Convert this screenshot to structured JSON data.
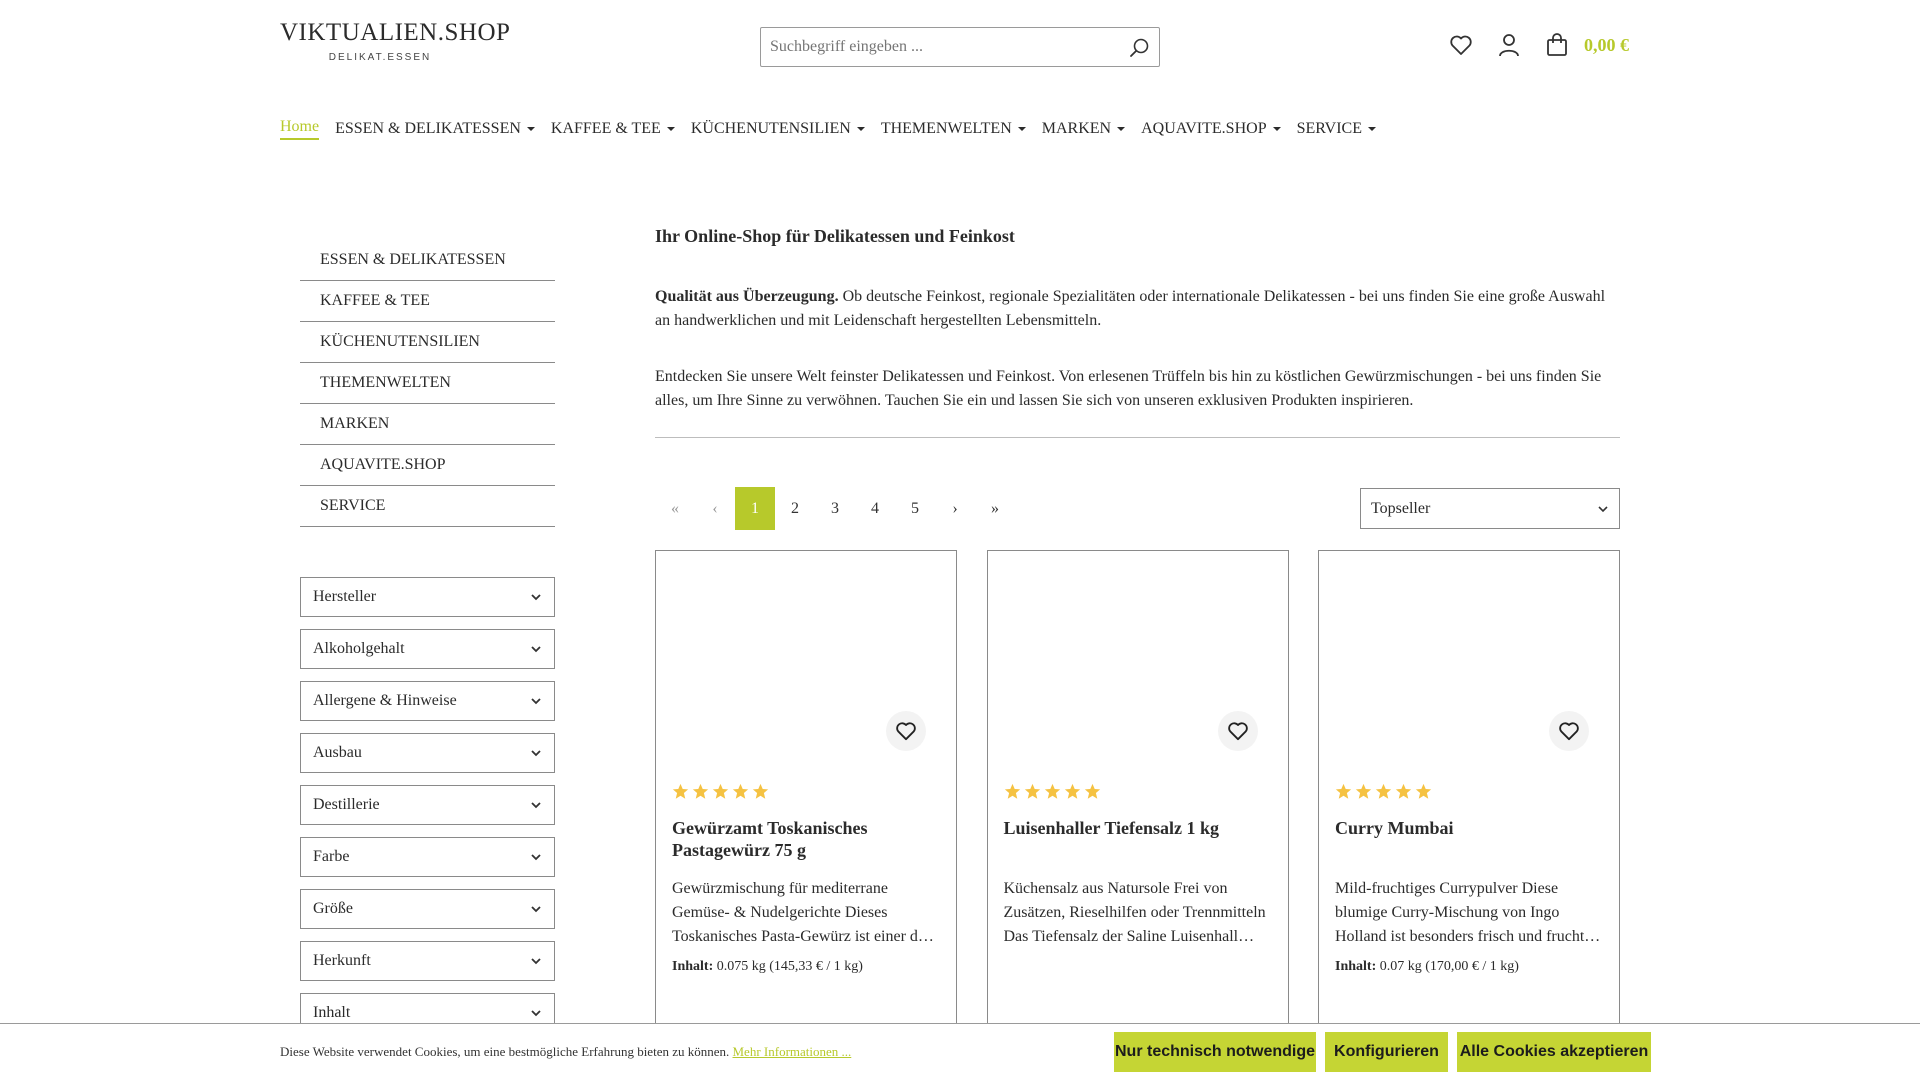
{
  "header": {
    "logo_main": "VIKTUALIEN.SHOP",
    "logo_sub": "DELIKAT.ESSEN",
    "search_placeholder": "Suchbegriff eingeben ...",
    "cart_total": "0,00 €"
  },
  "nav": {
    "items": [
      {
        "label": "Home",
        "active": true,
        "dropdown": false
      },
      {
        "label": "ESSEN & DELIKATESSEN",
        "dropdown": true
      },
      {
        "label": "KAFFEE & TEE",
        "dropdown": true
      },
      {
        "label": "KÜCHENUTENSILIEN",
        "dropdown": true
      },
      {
        "label": "THEMENWELTEN",
        "dropdown": true
      },
      {
        "label": "MARKEN",
        "dropdown": true
      },
      {
        "label": "AQUAVITE.SHOP",
        "dropdown": true
      },
      {
        "label": "SERVICE",
        "dropdown": true
      }
    ]
  },
  "sidebar": {
    "categories": [
      "ESSEN & DELIKATESSEN",
      "KAFFEE & TEE",
      "KÜCHENUTENSILIEN",
      "THEMENWELTEN",
      "MARKEN",
      "AQUAVITE.SHOP",
      "SERVICE"
    ],
    "filters": [
      "Hersteller",
      "Alkoholgehalt",
      "Allergene & Hinweise",
      "Ausbau",
      "Destillerie",
      "Farbe",
      "Größe",
      "Herkunft",
      "Inhalt"
    ]
  },
  "main": {
    "title": "Ihr Online-Shop für Delikatessen und Feinkost",
    "intro_bold": "Qualität aus Überzeugung.",
    "intro_text": " Ob deutsche Feinkost, regionale Spezialitäten oder internationale Delikatessen - bei uns finden Sie eine große Auswahl an handwerklichen und mit Leidenschaft hergestellten Lebensmitteln.",
    "paragraph2": "Entdecken Sie unsere Welt feinster Delikatessen und Feinkost. Von erlesenen Trüffeln bis hin zu köstlichen Gewürzmischungen - bei uns finden Sie alles, um Ihre Sinne zu verwöhnen. Tauchen Sie ein und lassen Sie sich von unseren exklusiven Produkten inspirieren."
  },
  "pagination": {
    "first": "«",
    "prev": "‹",
    "pages": [
      "1",
      "2",
      "3",
      "4",
      "5"
    ],
    "next": "›",
    "last": "»",
    "current": "1"
  },
  "sort": {
    "selected": "Topseller"
  },
  "products": [
    {
      "title": "Gewürzamt Toskanisches Pastagewürz 75 g",
      "description": "Gewürzmischung für mediterrane Gemüse- & Nudelgerichte Dieses Toskanisches Pasta-Gewürz ist einer d…",
      "content_label": "Inhalt:",
      "content_value": "0.075 kg (145,33 € / 1 kg)",
      "rating": 5
    },
    {
      "title": "Luisenhaller Tiefensalz 1 kg",
      "description": "Küchensalz aus Natursole Frei von Zusätzen, Rieselhilfen oder Trennmitteln Das Tiefensalz der Saline Luisenhall…",
      "content_label": "",
      "content_value": "",
      "rating": 5
    },
    {
      "title": "Curry Mumbai",
      "description": "Mild-fruchtiges Currypulver Diese blumige Curry-Mischung von Ingo Holland ist besonders frisch und frucht…",
      "content_label": "Inhalt:",
      "content_value": "0.07 kg (170,00 € / 1 kg)",
      "rating": 5
    }
  ],
  "cookie": {
    "text": "Diese Website verwendet Cookies, um eine bestmögliche Erfahrung bieten zu können.",
    "link": "Mehr Informationen ...",
    "btn_necessary": "Nur technisch notwendige",
    "btn_configure": "Konfigurieren",
    "btn_accept": "Alle Cookies akzeptieren"
  },
  "colors": {
    "accent": "#b7c92b",
    "button": "#c5d534",
    "star": "#f5c242"
  }
}
